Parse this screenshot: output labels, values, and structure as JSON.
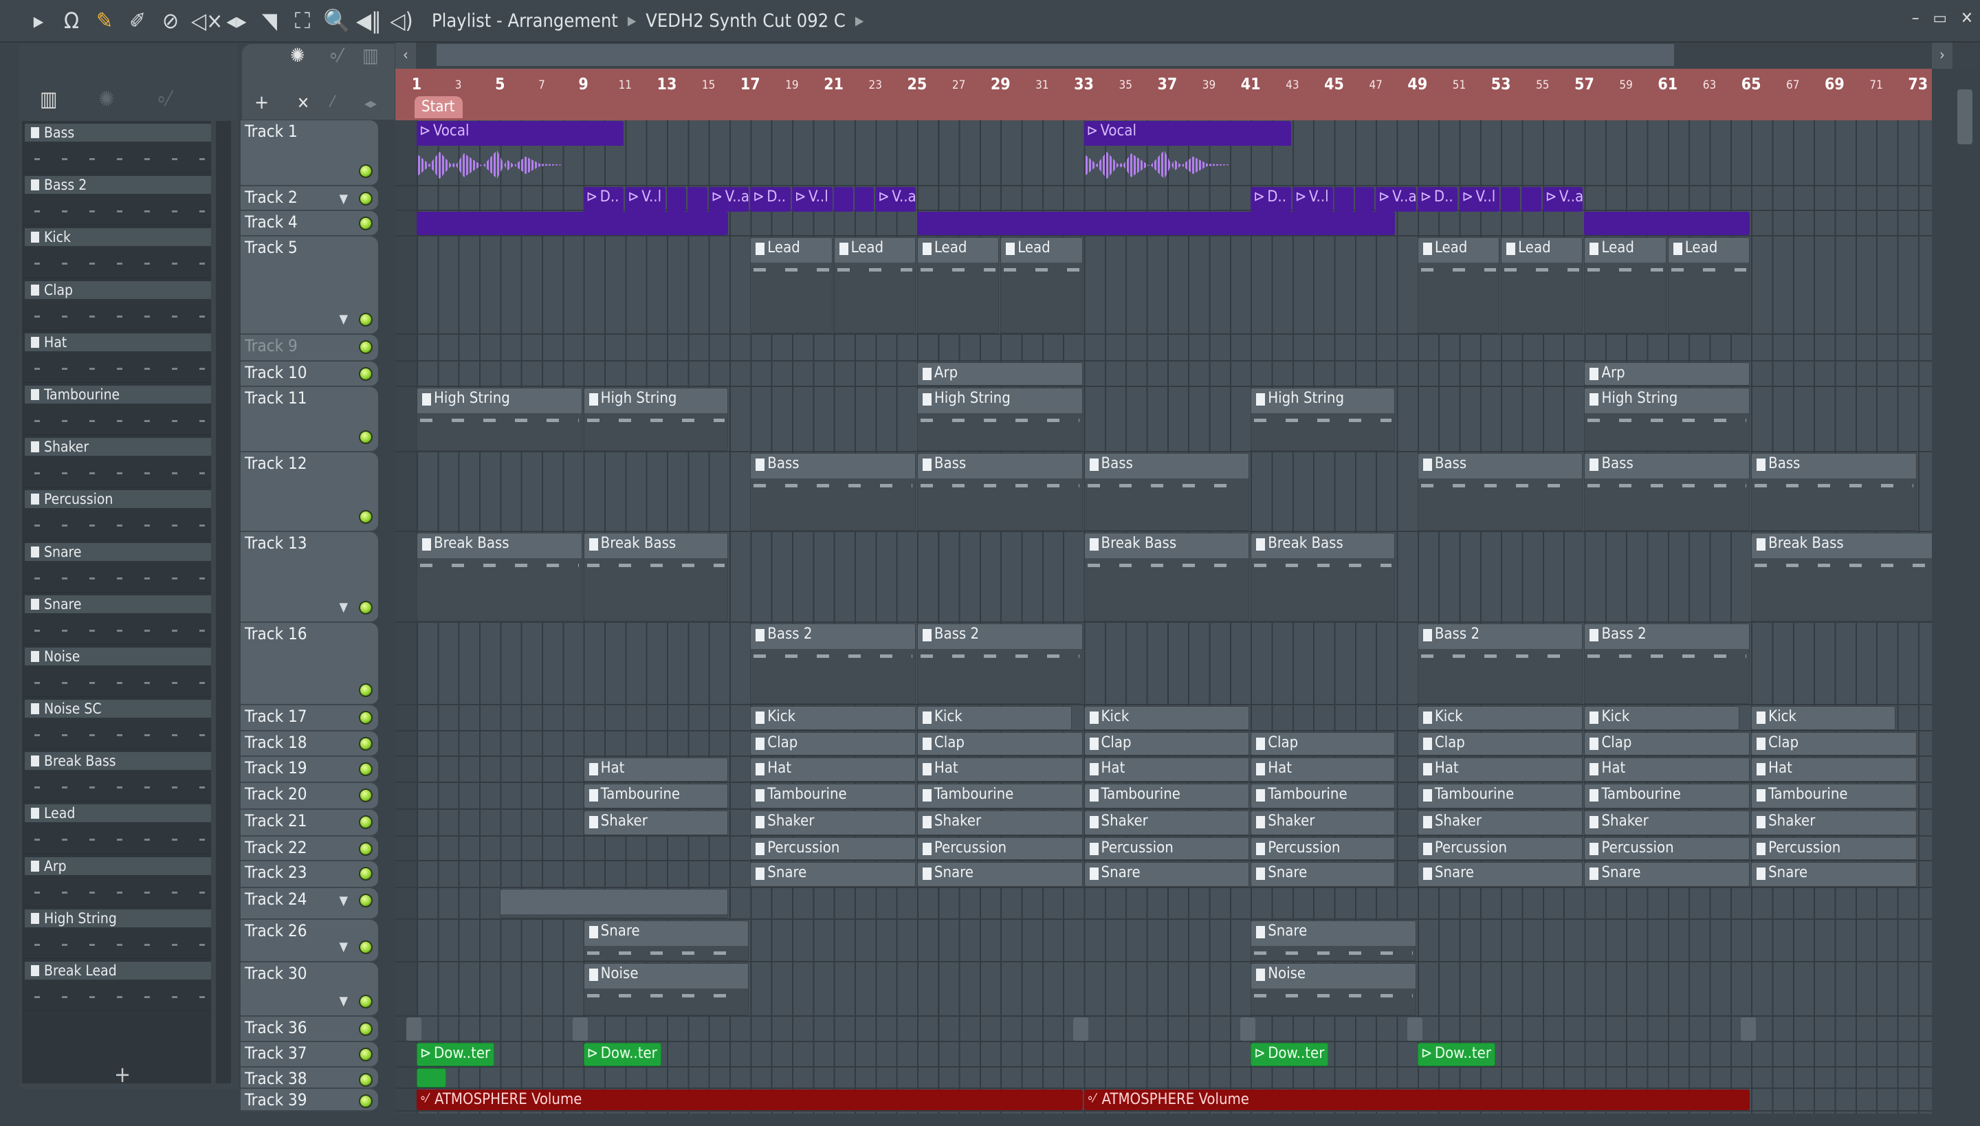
{
  "toolbar": {
    "icons": [
      "play-arrow-icon",
      "magnet-icon",
      "pencil-icon",
      "paint-brush-icon",
      "delete-icon",
      "mute-icon",
      "slip-icon",
      "slice-icon",
      "select-icon",
      "zoom-icon",
      "playback-icon",
      "speaker-icon"
    ],
    "glyphs": [
      "▸",
      "Ω",
      "✎",
      "✐",
      "⊘",
      "◁×",
      "◂▸",
      "◥",
      "⛶",
      "🔍",
      "◀‖",
      "◁)"
    ],
    "title": "Playlist - Arrangement",
    "pattern": "VEDH2 Synth Cut 092 C"
  },
  "window_controls": [
    "–",
    "▭",
    "✕"
  ],
  "left_panel": {
    "channels": [
      "Bass",
      "Bass 2",
      "Kick",
      "Clap",
      "Hat",
      "Tambourine",
      "Shaker",
      "Percussion",
      "Snare",
      "Snare",
      "Noise",
      "Noise SC",
      "Break Bass",
      "Lead",
      "Arp",
      "High String",
      "Break Lead"
    ],
    "add_label": "+"
  },
  "ruler": {
    "start_label": "Start",
    "first_bar": 1,
    "last_bar": 73
  },
  "colors": {
    "ruler": "#9b5658",
    "audio": "#4a1a9a",
    "green": "#1ea33a",
    "automation": "#8c0b0b",
    "led": "#8fd22a"
  },
  "tracks": [
    {
      "name": "Track 1",
      "clips": [
        {
          "label": "Vocal",
          "bar": 1,
          "len": 10,
          "kind": "audio",
          "wave": true
        },
        {
          "label": "Vocal",
          "bar": 33,
          "len": 10,
          "kind": "audio",
          "wave": true
        }
      ]
    },
    {
      "name": "Track 2",
      "arrow": true,
      "clips": [
        {
          "label": "D..",
          "bar": 9,
          "len": 2,
          "kind": "audio"
        },
        {
          "label": "V..l",
          "bar": 11,
          "len": 2,
          "kind": "audio"
        },
        {
          "label": "",
          "bar": 13,
          "len": 1,
          "kind": "audio"
        },
        {
          "label": "",
          "bar": 14,
          "len": 1,
          "kind": "audio"
        },
        {
          "label": "V..al",
          "bar": 15,
          "len": 2,
          "kind": "audio"
        },
        {
          "label": "D..",
          "bar": 17,
          "len": 2,
          "kind": "audio"
        },
        {
          "label": "V..l",
          "bar": 19,
          "len": 2,
          "kind": "audio"
        },
        {
          "label": "",
          "bar": 21,
          "len": 1,
          "kind": "audio"
        },
        {
          "label": "",
          "bar": 22,
          "len": 1,
          "kind": "audio"
        },
        {
          "label": "V..al",
          "bar": 23,
          "len": 2,
          "kind": "audio"
        },
        {
          "label": "D..",
          "bar": 41,
          "len": 2,
          "kind": "audio"
        },
        {
          "label": "V..l",
          "bar": 43,
          "len": 2,
          "kind": "audio"
        },
        {
          "label": "",
          "bar": 45,
          "len": 1,
          "kind": "audio"
        },
        {
          "label": "",
          "bar": 46,
          "len": 1,
          "kind": "audio"
        },
        {
          "label": "V..al",
          "bar": 47,
          "len": 2,
          "kind": "audio"
        },
        {
          "label": "D..",
          "bar": 49,
          "len": 2,
          "kind": "audio"
        },
        {
          "label": "V..l",
          "bar": 51,
          "len": 2,
          "kind": "audio"
        },
        {
          "label": "",
          "bar": 53,
          "len": 1,
          "kind": "audio"
        },
        {
          "label": "",
          "bar": 54,
          "len": 1,
          "kind": "audio"
        },
        {
          "label": "V..al",
          "bar": 55,
          "len": 2,
          "kind": "audio"
        }
      ]
    },
    {
      "name": "Track 4",
      "clips": [
        {
          "label": "",
          "bar": 1,
          "len": 15,
          "kind": "audio"
        },
        {
          "label": "",
          "bar": 25,
          "len": 23,
          "kind": "audio"
        },
        {
          "label": "",
          "bar": 57,
          "len": 8,
          "kind": "audio"
        }
      ]
    },
    {
      "name": "Track 5",
      "arrow": true,
      "clips": [
        {
          "label": "Lead",
          "bar": 17,
          "len": 4,
          "kind": "pattern"
        },
        {
          "label": "Lead",
          "bar": 21,
          "len": 4,
          "kind": "pattern"
        },
        {
          "label": "Lead",
          "bar": 25,
          "len": 4,
          "kind": "pattern"
        },
        {
          "label": "Lead",
          "bar": 29,
          "len": 4,
          "kind": "pattern"
        },
        {
          "label": "Lead",
          "bar": 49,
          "len": 4,
          "kind": "pattern"
        },
        {
          "label": "Lead",
          "bar": 53,
          "len": 4,
          "kind": "pattern"
        },
        {
          "label": "Lead",
          "bar": 57,
          "len": 4,
          "kind": "pattern"
        },
        {
          "label": "Lead",
          "bar": 61,
          "len": 4,
          "kind": "pattern"
        }
      ]
    },
    {
      "name": "Track 9",
      "dim": true,
      "clips": []
    },
    {
      "name": "Track 10",
      "clips": [
        {
          "label": "Arp",
          "bar": 25,
          "len": 8,
          "kind": "pattern"
        },
        {
          "label": "Arp",
          "bar": 57,
          "len": 8,
          "kind": "pattern"
        }
      ]
    },
    {
      "name": "Track 11",
      "clips": [
        {
          "label": "High String",
          "bar": 1,
          "len": 8,
          "kind": "pattern"
        },
        {
          "label": "High String",
          "bar": 9,
          "len": 7,
          "kind": "pattern"
        },
        {
          "label": "High String",
          "bar": 25,
          "len": 8,
          "kind": "pattern"
        },
        {
          "label": "High String",
          "bar": 41,
          "len": 7,
          "kind": "pattern"
        },
        {
          "label": "High String",
          "bar": 57,
          "len": 8,
          "kind": "pattern"
        }
      ]
    },
    {
      "name": "Track 12",
      "clips": [
        {
          "label": "Bass",
          "bar": 17,
          "len": 8,
          "kind": "pattern"
        },
        {
          "label": "Bass",
          "bar": 25,
          "len": 8,
          "kind": "pattern"
        },
        {
          "label": "Bass",
          "bar": 33,
          "len": 8,
          "kind": "pattern"
        },
        {
          "label": "Bass",
          "bar": 49,
          "len": 8,
          "kind": "pattern"
        },
        {
          "label": "Bass",
          "bar": 57,
          "len": 8,
          "kind": "pattern"
        },
        {
          "label": "Bass",
          "bar": 65,
          "len": 8,
          "kind": "pattern"
        }
      ]
    },
    {
      "name": "Track 13",
      "arrow": true,
      "clips": [
        {
          "label": "Break Bass",
          "bar": 1,
          "len": 8,
          "kind": "pattern"
        },
        {
          "label": "Break Bass",
          "bar": 9,
          "len": 7,
          "kind": "pattern"
        },
        {
          "label": "Break Bass",
          "bar": 33,
          "len": 8,
          "kind": "pattern"
        },
        {
          "label": "Break Bass",
          "bar": 41,
          "len": 7,
          "kind": "pattern"
        },
        {
          "label": "Break Bass",
          "bar": 65,
          "len": 9,
          "kind": "pattern"
        }
      ]
    },
    {
      "name": "Track 16",
      "clips": [
        {
          "label": "Bass 2",
          "bar": 17,
          "len": 8,
          "kind": "pattern"
        },
        {
          "label": "Bass 2",
          "bar": 25,
          "len": 8,
          "kind": "pattern"
        },
        {
          "label": "Bass 2",
          "bar": 49,
          "len": 8,
          "kind": "pattern"
        },
        {
          "label": "Bass 2",
          "bar": 57,
          "len": 8,
          "kind": "pattern"
        }
      ]
    },
    {
      "name": "Track 17",
      "clips": [
        {
          "label": "Kick",
          "bar": 17,
          "len": 8,
          "kind": "pattern"
        },
        {
          "label": "Kick",
          "bar": 25,
          "len": 7.5,
          "kind": "pattern"
        },
        {
          "label": "Kick",
          "bar": 33,
          "len": 8,
          "kind": "pattern"
        },
        {
          "label": "Kick",
          "bar": 49,
          "len": 8,
          "kind": "pattern"
        },
        {
          "label": "Kick",
          "bar": 57,
          "len": 7.5,
          "kind": "pattern"
        },
        {
          "label": "Kick",
          "bar": 65,
          "len": 7,
          "kind": "pattern"
        }
      ]
    },
    {
      "name": "Track 18",
      "clips": [
        {
          "label": "Clap",
          "bar": 17,
          "len": 8,
          "kind": "pattern"
        },
        {
          "label": "Clap",
          "bar": 25,
          "len": 8,
          "kind": "pattern"
        },
        {
          "label": "Clap",
          "bar": 33,
          "len": 8,
          "kind": "pattern"
        },
        {
          "label": "Clap",
          "bar": 41,
          "len": 7,
          "kind": "pattern"
        },
        {
          "label": "Clap",
          "bar": 49,
          "len": 8,
          "kind": "pattern"
        },
        {
          "label": "Clap",
          "bar": 57,
          "len": 8,
          "kind": "pattern"
        },
        {
          "label": "Clap",
          "bar": 65,
          "len": 8,
          "kind": "pattern"
        }
      ]
    },
    {
      "name": "Track 19",
      "clips": [
        {
          "label": "Hat",
          "bar": 9,
          "len": 7,
          "kind": "pattern"
        },
        {
          "label": "Hat",
          "bar": 17,
          "len": 8,
          "kind": "pattern"
        },
        {
          "label": "Hat",
          "bar": 25,
          "len": 8,
          "kind": "pattern"
        },
        {
          "label": "Hat",
          "bar": 33,
          "len": 8,
          "kind": "pattern"
        },
        {
          "label": "Hat",
          "bar": 41,
          "len": 7,
          "kind": "pattern"
        },
        {
          "label": "Hat",
          "bar": 49,
          "len": 8,
          "kind": "pattern"
        },
        {
          "label": "Hat",
          "bar": 57,
          "len": 8,
          "kind": "pattern"
        },
        {
          "label": "Hat",
          "bar": 65,
          "len": 8,
          "kind": "pattern"
        }
      ]
    },
    {
      "name": "Track 20",
      "clips": [
        {
          "label": "Tambourine",
          "bar": 9,
          "len": 7,
          "kind": "pattern"
        },
        {
          "label": "Tambourine",
          "bar": 17,
          "len": 8,
          "kind": "pattern"
        },
        {
          "label": "Tambourine",
          "bar": 25,
          "len": 8,
          "kind": "pattern"
        },
        {
          "label": "Tambourine",
          "bar": 33,
          "len": 8,
          "kind": "pattern"
        },
        {
          "label": "Tambourine",
          "bar": 41,
          "len": 7,
          "kind": "pattern"
        },
        {
          "label": "Tambourine",
          "bar": 49,
          "len": 8,
          "kind": "pattern"
        },
        {
          "label": "Tambourine",
          "bar": 57,
          "len": 8,
          "kind": "pattern"
        },
        {
          "label": "Tambourine",
          "bar": 65,
          "len": 8,
          "kind": "pattern"
        }
      ]
    },
    {
      "name": "Track 21",
      "clips": [
        {
          "label": "Shaker",
          "bar": 9,
          "len": 7,
          "kind": "pattern"
        },
        {
          "label": "Shaker",
          "bar": 17,
          "len": 8,
          "kind": "pattern"
        },
        {
          "label": "Shaker",
          "bar": 25,
          "len": 8,
          "kind": "pattern"
        },
        {
          "label": "Shaker",
          "bar": 33,
          "len": 8,
          "kind": "pattern"
        },
        {
          "label": "Shaker",
          "bar": 41,
          "len": 7,
          "kind": "pattern"
        },
        {
          "label": "Shaker",
          "bar": 49,
          "len": 8,
          "kind": "pattern"
        },
        {
          "label": "Shaker",
          "bar": 57,
          "len": 8,
          "kind": "pattern"
        },
        {
          "label": "Shaker",
          "bar": 65,
          "len": 8,
          "kind": "pattern"
        }
      ]
    },
    {
      "name": "Track 22",
      "clips": [
        {
          "label": "Percussion",
          "bar": 17,
          "len": 8,
          "kind": "pattern"
        },
        {
          "label": "Percussion",
          "bar": 25,
          "len": 8,
          "kind": "pattern"
        },
        {
          "label": "Percussion",
          "bar": 33,
          "len": 8,
          "kind": "pattern"
        },
        {
          "label": "Percussion",
          "bar": 41,
          "len": 7,
          "kind": "pattern"
        },
        {
          "label": "Percussion",
          "bar": 49,
          "len": 8,
          "kind": "pattern"
        },
        {
          "label": "Percussion",
          "bar": 57,
          "len": 8,
          "kind": "pattern"
        },
        {
          "label": "Percussion",
          "bar": 65,
          "len": 8,
          "kind": "pattern"
        }
      ]
    },
    {
      "name": "Track 23",
      "clips": [
        {
          "label": "Snare",
          "bar": 17,
          "len": 8,
          "kind": "pattern"
        },
        {
          "label": "Snare",
          "bar": 25,
          "len": 8,
          "kind": "pattern"
        },
        {
          "label": "Snare",
          "bar": 33,
          "len": 8,
          "kind": "pattern"
        },
        {
          "label": "Snare",
          "bar": 41,
          "len": 7,
          "kind": "pattern"
        },
        {
          "label": "Snare",
          "bar": 49,
          "len": 8,
          "kind": "pattern"
        },
        {
          "label": "Snare",
          "bar": 57,
          "len": 8,
          "kind": "pattern"
        },
        {
          "label": "Snare",
          "bar": 65,
          "len": 8,
          "kind": "pattern"
        }
      ]
    },
    {
      "name": "Track 24",
      "arrow": true,
      "clips": [
        {
          "label": "",
          "bar": 5,
          "len": 11,
          "kind": "pattern"
        }
      ]
    },
    {
      "name": "Track 26",
      "arrow": true,
      "clips": [
        {
          "label": "Snare",
          "bar": 9,
          "len": 8,
          "kind": "pattern"
        },
        {
          "label": "Snare",
          "bar": 41,
          "len": 8,
          "kind": "pattern"
        }
      ]
    },
    {
      "name": "Track 30",
      "arrow": true,
      "clips": [
        {
          "label": "Noise",
          "bar": 9,
          "len": 8,
          "kind": "pattern"
        },
        {
          "label": "Noise",
          "bar": 41,
          "len": 8,
          "kind": "pattern"
        }
      ]
    },
    {
      "name": "Track 36",
      "clips": [
        {
          "label": "",
          "bar": 0.5,
          "len": 0.7,
          "kind": "marker"
        },
        {
          "label": "",
          "bar": 8.5,
          "len": 0.7,
          "kind": "marker"
        },
        {
          "label": "",
          "bar": 32.5,
          "len": 0.7,
          "kind": "marker"
        },
        {
          "label": "",
          "bar": 40.5,
          "len": 0.7,
          "kind": "marker"
        },
        {
          "label": "",
          "bar": 48.5,
          "len": 0.7,
          "kind": "marker"
        },
        {
          "label": "",
          "bar": 64.5,
          "len": 0.7,
          "kind": "marker"
        }
      ]
    },
    {
      "name": "Track 37",
      "clips": [
        {
          "label": "Dow..ter",
          "bar": 1,
          "len": 3.8,
          "kind": "green"
        },
        {
          "label": "Dow..ter",
          "bar": 9,
          "len": 3.8,
          "kind": "green"
        },
        {
          "label": "Dow..ter",
          "bar": 41,
          "len": 3.8,
          "kind": "green"
        },
        {
          "label": "Dow..ter",
          "bar": 49,
          "len": 3.8,
          "kind": "green"
        }
      ]
    },
    {
      "name": "Track 38",
      "clips": [
        {
          "label": "",
          "bar": 1,
          "len": 1.5,
          "kind": "green"
        }
      ]
    },
    {
      "name": "Track 39",
      "clips": [
        {
          "label": "ATMOSPHERE Volume",
          "bar": 1,
          "len": 32,
          "kind": "auto"
        },
        {
          "label": "ATMOSPHERE Volume",
          "bar": 33,
          "len": 32,
          "kind": "auto"
        }
      ]
    }
  ]
}
